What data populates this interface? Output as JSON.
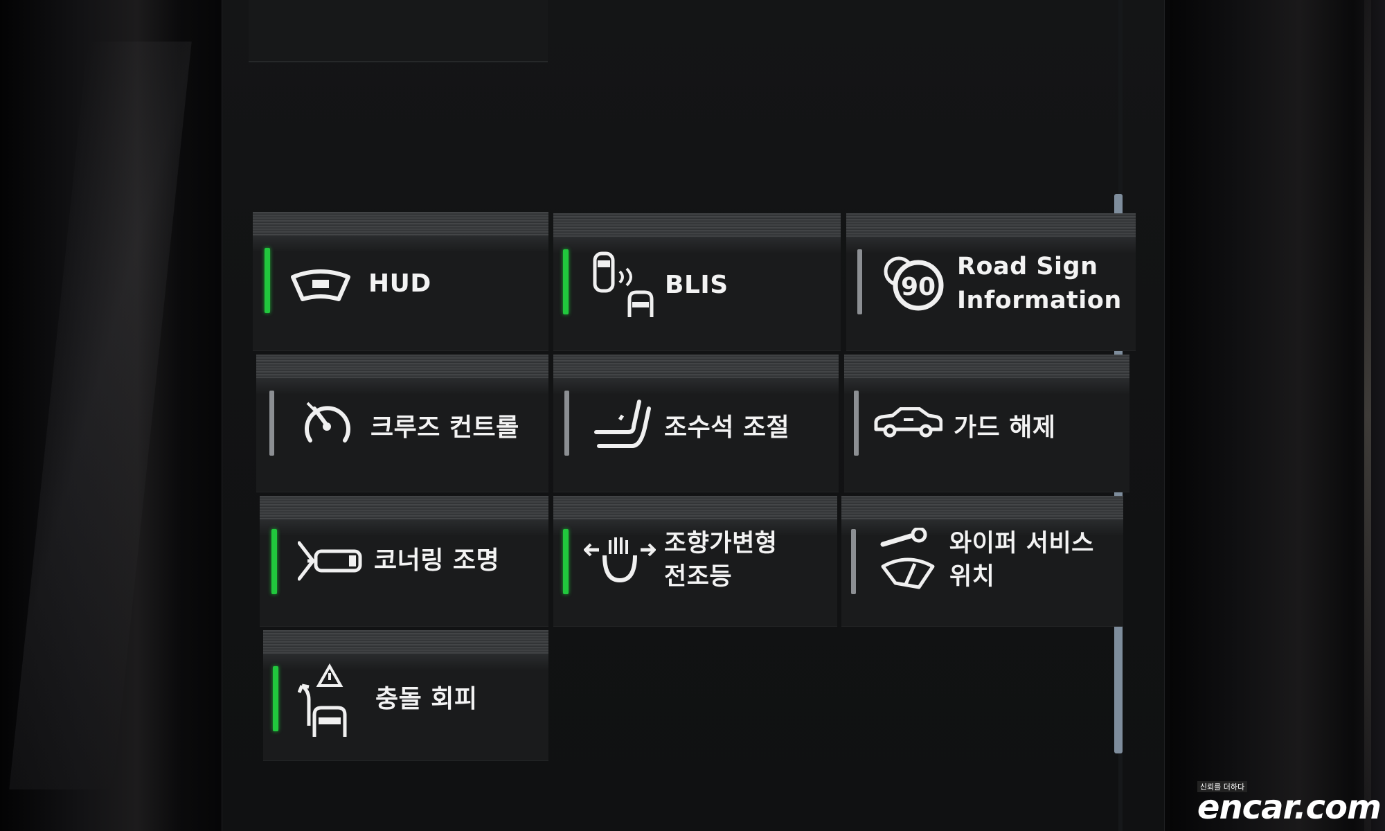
{
  "top_partial_label": "",
  "tiles": [
    {
      "id": "hud",
      "lines": [
        "HUD"
      ],
      "active": true,
      "icon": "windshield-hud-icon"
    },
    {
      "id": "blis",
      "lines": [
        "BLIS"
      ],
      "active": true,
      "icon": "blind-spot-car-icon"
    },
    {
      "id": "road-sign",
      "lines": [
        "Road Sign",
        "Information"
      ],
      "active": false,
      "icon": "speed-limit-sign-icon"
    },
    {
      "id": "cruise",
      "lines": [
        "크루즈 컨트롤"
      ],
      "active": false,
      "icon": "cruise-control-speedometer-icon"
    },
    {
      "id": "passenger-seat",
      "lines": [
        "조수석 조절"
      ],
      "active": false,
      "icon": "seat-icon"
    },
    {
      "id": "guard-release",
      "lines": [
        "가드 해제"
      ],
      "active": false,
      "icon": "car-alarm-icon"
    },
    {
      "id": "cornering-light",
      "lines": [
        "코너링 조명"
      ],
      "active": true,
      "icon": "cornering-light-icon"
    },
    {
      "id": "adaptive-headlight",
      "lines": [
        "조향가변형",
        "전조등"
      ],
      "active": true,
      "icon": "adaptive-headlight-icon"
    },
    {
      "id": "wiper-service",
      "lines": [
        "와이퍼 서비스",
        "위치"
      ],
      "active": false,
      "icon": "wiper-service-icon"
    },
    {
      "id": "collision-avoid",
      "lines": [
        "충돌 회피"
      ],
      "active": true,
      "icon": "collision-avoidance-icon"
    }
  ],
  "watermark": {
    "small": "신뢰를 더하다",
    "brand": "encar.com"
  },
  "colors": {
    "active": "#21c73d",
    "inactive": "#8c8f93",
    "text": "#f3f3f3",
    "scroll": "#7e8d9c"
  }
}
